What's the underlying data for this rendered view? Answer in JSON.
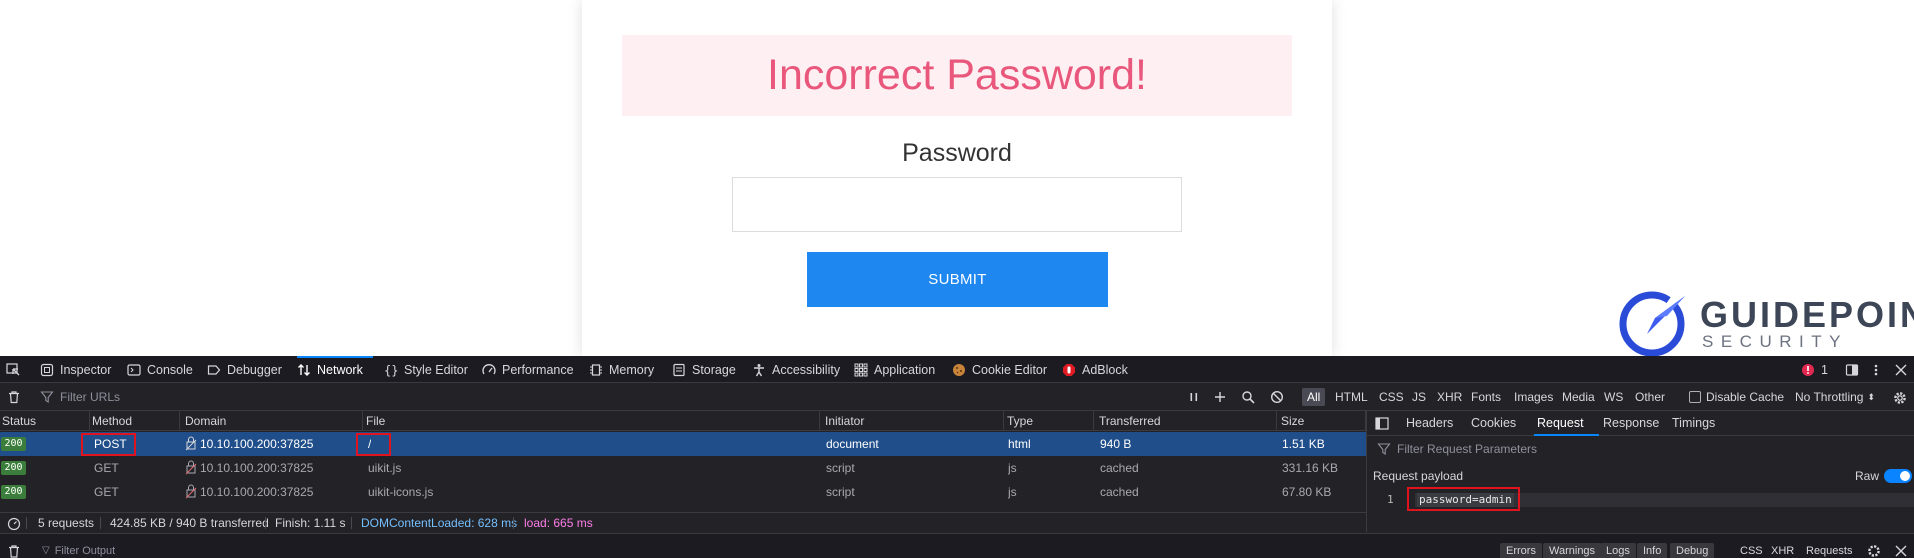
{
  "page": {
    "alert_text": "Incorrect Password!",
    "password_label": "Password",
    "password_value": "",
    "submit_label": "SUBMIT",
    "logo_line1": "GUIDEPOINT",
    "logo_line2": "SECURITY",
    "colors": {
      "alert_bg": "#fef0f2",
      "alert_text": "#e9587c",
      "submit_bg": "#1e87f0"
    }
  },
  "devtools": {
    "tabs": [
      {
        "label": "Inspector",
        "icon": "inspector-icon"
      },
      {
        "label": "Console",
        "icon": "console-icon"
      },
      {
        "label": "Debugger",
        "icon": "debugger-icon"
      },
      {
        "label": "Network",
        "icon": "network-icon",
        "active": true
      },
      {
        "label": "Style Editor",
        "icon": "style-editor-icon"
      },
      {
        "label": "Performance",
        "icon": "performance-icon"
      },
      {
        "label": "Memory",
        "icon": "memory-icon"
      },
      {
        "label": "Storage",
        "icon": "storage-icon"
      },
      {
        "label": "Accessibility",
        "icon": "accessibility-icon"
      },
      {
        "label": "Application",
        "icon": "application-icon"
      },
      {
        "label": "Cookie Editor",
        "icon": "cookie-icon"
      },
      {
        "label": "AdBlock",
        "icon": "adblock-icon"
      }
    ],
    "error_count": "1",
    "filter_placeholder": "Filter URLs",
    "type_filters": [
      "All",
      "HTML",
      "CSS",
      "JS",
      "XHR",
      "Fonts",
      "Images",
      "Media",
      "WS",
      "Other"
    ],
    "disable_cache_label": "Disable Cache",
    "throttling_label": "No Throttling",
    "columns": [
      "Status",
      "Method",
      "Domain",
      "File",
      "Initiator",
      "Type",
      "Transferred",
      "Size"
    ],
    "rows": [
      {
        "status": "200",
        "method": "POST",
        "domain": "10.10.100.200:37825",
        "file": "/",
        "initiator": "document",
        "type": "html",
        "transferred": "940 B",
        "size": "1.51 KB"
      },
      {
        "status": "200",
        "method": "GET",
        "domain": "10.10.100.200:37825",
        "file": "uikit.js",
        "initiator": "script",
        "type": "js",
        "transferred": "cached",
        "size": "331.16 KB"
      },
      {
        "status": "200",
        "method": "GET",
        "domain": "10.10.100.200:37825",
        "file": "uikit-icons.js",
        "initiator": "script",
        "type": "js",
        "transferred": "cached",
        "size": "67.80 KB"
      }
    ],
    "summary": {
      "requests": "5 requests",
      "transferred": "424.85 KB / 940 B transferred",
      "finish": "Finish: 1.11 s",
      "dom_content_loaded": "DOMContentLoaded: 628 ms",
      "load": "load: 665 ms"
    },
    "side_tabs": [
      "Headers",
      "Cookies",
      "Request",
      "Response",
      "Timings"
    ],
    "side_active": "Request",
    "side_filter_placeholder": "Filter Request Parameters",
    "payload_label": "Request payload",
    "raw_label": "Raw",
    "payload_line_no": "1",
    "payload_text": "password=admin",
    "console": {
      "filter_placeholder": "Filter Output",
      "levels": [
        "Errors",
        "Warnings",
        "Logs",
        "Info",
        "Debug"
      ],
      "categories": [
        "CSS",
        "XHR",
        "Requests"
      ]
    }
  }
}
